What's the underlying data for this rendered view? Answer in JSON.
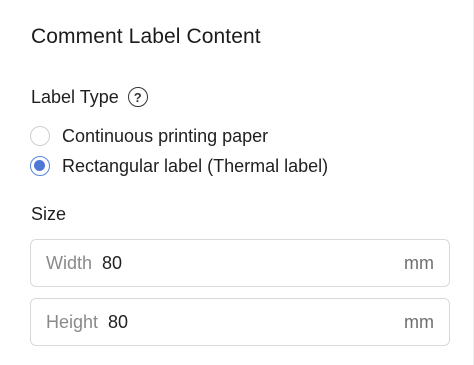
{
  "section": {
    "title": "Comment Label Content"
  },
  "label_type": {
    "title": "Label Type",
    "help_glyph": "?",
    "help_icon": "question-circle-icon",
    "options": [
      {
        "label": "Continuous printing paper",
        "selected": false
      },
      {
        "label": "Rectangular label (Thermal label)",
        "selected": true
      }
    ]
  },
  "size": {
    "title": "Size",
    "width": {
      "prefix": "Width",
      "value": "80",
      "suffix": "mm"
    },
    "height": {
      "prefix": "Height",
      "value": "80",
      "suffix": "mm"
    }
  },
  "colors": {
    "accent": "#4f78d6",
    "text": "#1f1f1f",
    "muted": "#8a8a8a",
    "border": "#d9d9d9"
  }
}
